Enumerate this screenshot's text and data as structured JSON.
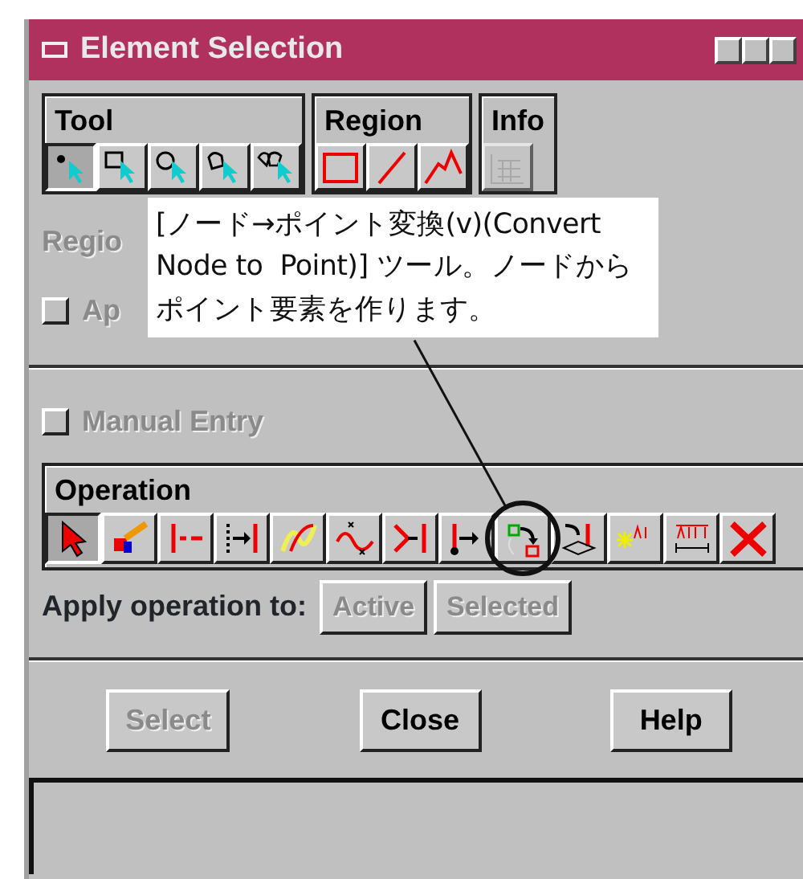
{
  "window": {
    "title": "Element Selection"
  },
  "tool_groups": [
    {
      "title": "Tool",
      "buttons": [
        {
          "kind": "point",
          "selected": true
        },
        {
          "kind": "rectangle",
          "selected": false
        },
        {
          "kind": "circle",
          "selected": false
        },
        {
          "kind": "shape",
          "selected": false
        },
        {
          "kind": "shapes",
          "selected": false
        }
      ]
    },
    {
      "title": "Region",
      "buttons": [
        {
          "kind": "region-point",
          "selected": false
        },
        {
          "kind": "region-line",
          "selected": false
        },
        {
          "kind": "region-poly",
          "selected": false
        }
      ]
    },
    {
      "title": "Info",
      "buttons": [
        {
          "kind": "info",
          "selected": false,
          "disabled": true
        }
      ]
    }
  ],
  "region_label": {
    "text": "Regio",
    "disabled": true
  },
  "apply_checkbox": {
    "label": "Ap",
    "checked": false,
    "disabled": true
  },
  "manual_entry": {
    "label": "Manual Entry",
    "checked": false,
    "disabled": true
  },
  "operation": {
    "title": "Operation",
    "buttons": [
      {
        "kind": "select-arrow",
        "selected": true
      },
      {
        "kind": "brush",
        "selected": false
      },
      {
        "kind": "break",
        "selected": false
      },
      {
        "kind": "extend",
        "selected": false
      },
      {
        "kind": "curve",
        "selected": false
      },
      {
        "kind": "wave",
        "selected": false
      },
      {
        "kind": "join",
        "selected": false
      },
      {
        "kind": "end",
        "selected": false
      },
      {
        "kind": "node-to-point",
        "selected": false,
        "highlighted": true
      },
      {
        "kind": "drop",
        "selected": false
      },
      {
        "kind": "text-star",
        "selected": false
      },
      {
        "kind": "text-dim",
        "selected": false
      },
      {
        "kind": "delete",
        "selected": false
      }
    ]
  },
  "apply_to": {
    "label": "Apply operation to:",
    "buttons": [
      {
        "label": "Active",
        "disabled": true
      },
      {
        "label": "Selected",
        "disabled": true
      }
    ]
  },
  "buttons": [
    {
      "label": "Select",
      "disabled": true
    },
    {
      "label": "Close",
      "disabled": false
    },
    {
      "label": "Help",
      "disabled": false
    }
  ],
  "callout": {
    "text": "[ノード→ポイント変換(v)(Convert Node to  Point)] ツール。ノードからポイント要素を作ります。"
  }
}
